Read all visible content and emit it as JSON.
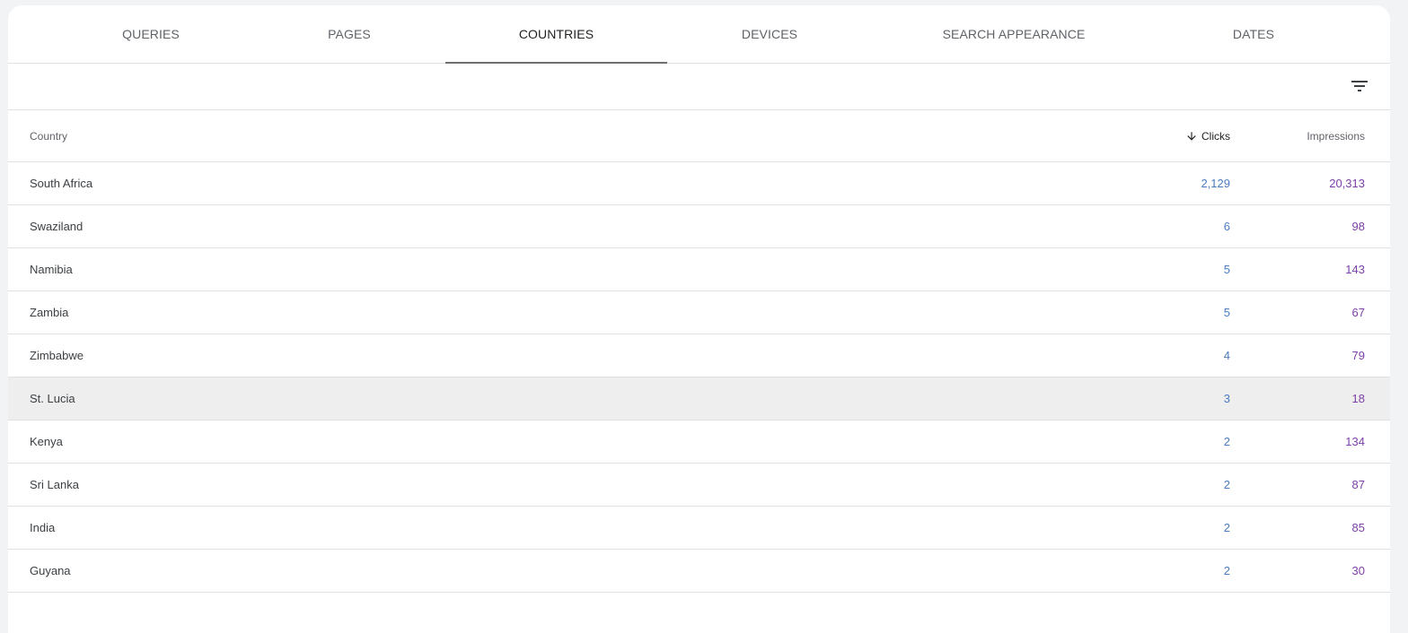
{
  "tabs": [
    {
      "label": "QUERIES"
    },
    {
      "label": "PAGES"
    },
    {
      "label": "COUNTRIES"
    },
    {
      "label": "DEVICES"
    },
    {
      "label": "SEARCH APPEARANCE"
    },
    {
      "label": "DATES"
    }
  ],
  "active_tab": "COUNTRIES",
  "table": {
    "headers": {
      "country": "Country",
      "clicks": "Clicks",
      "impressions": "Impressions"
    },
    "sort": "clicks-descending",
    "rows": [
      {
        "country": "South Africa",
        "clicks": "2,129",
        "impressions": "20,313"
      },
      {
        "country": "Swaziland",
        "clicks": "6",
        "impressions": "98"
      },
      {
        "country": "Namibia",
        "clicks": "5",
        "impressions": "143"
      },
      {
        "country": "Zambia",
        "clicks": "5",
        "impressions": "67"
      },
      {
        "country": "Zimbabwe",
        "clicks": "4",
        "impressions": "79"
      },
      {
        "country": "St. Lucia",
        "clicks": "3",
        "impressions": "18"
      },
      {
        "country": "Kenya",
        "clicks": "2",
        "impressions": "134"
      },
      {
        "country": "Sri Lanka",
        "clicks": "2",
        "impressions": "87"
      },
      {
        "country": "India",
        "clicks": "2",
        "impressions": "85"
      },
      {
        "country": "Guyana",
        "clicks": "2",
        "impressions": "30"
      }
    ]
  },
  "highlighted_row": "St. Lucia",
  "colors": {
    "clicks": "#4a7bbf",
    "impressions": "#7b3fa6",
    "active_tab_indicator": "#707070"
  }
}
